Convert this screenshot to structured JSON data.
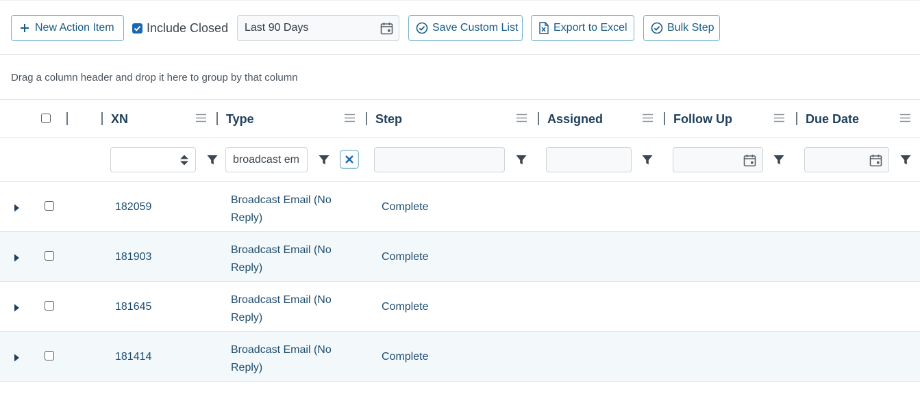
{
  "toolbar": {
    "new_action_label": "New Action Item",
    "include_closed_label": "Include Closed",
    "include_closed_checked": true,
    "date_range_value": "Last 90 Days",
    "save_custom_list_label": "Save Custom List",
    "export_label": "Export to Excel",
    "bulk_step_label": "Bulk Step"
  },
  "group_hint": "Drag a column header and drop it here to group by that column",
  "columns": {
    "xn": "XN",
    "type": "Type",
    "step": "Step",
    "assigned": "Assigned",
    "follow_up": "Follow Up",
    "due_date": "Due Date"
  },
  "filters": {
    "xn": "",
    "type": "broadcast em",
    "step": "",
    "assigned": "",
    "follow_up": "",
    "due_date": ""
  },
  "rows": [
    {
      "xn": "182059",
      "type": "Broadcast Email (No Reply)",
      "step": "Complete"
    },
    {
      "xn": "181903",
      "type": "Broadcast Email (No Reply)",
      "step": "Complete"
    },
    {
      "xn": "181645",
      "type": "Broadcast Email (No Reply)",
      "step": "Complete"
    },
    {
      "xn": "181414",
      "type": "Broadcast Email (No Reply)",
      "step": "Complete"
    }
  ],
  "colors": {
    "accent": "#175b85",
    "button_border": "#74b3cf",
    "checkbox_checked": "#1967b5",
    "row_alt": "#f3f8fb"
  },
  "icons": [
    "plus-icon",
    "calendar-icon",
    "check-circle-icon",
    "excel-file-icon",
    "column-menu-icon",
    "filter-icon",
    "spinner-icon",
    "clear-x-icon",
    "expand-caret-icon"
  ]
}
